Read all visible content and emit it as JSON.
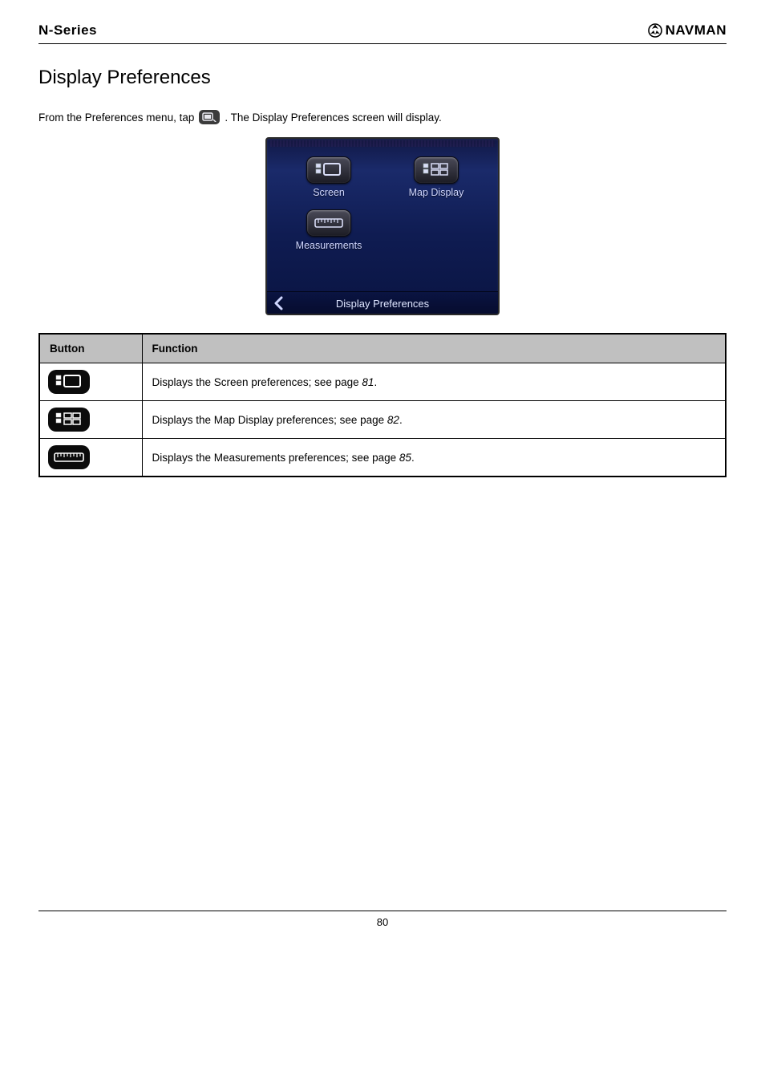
{
  "header": {
    "series": "N-Series",
    "brand": "NAVMAN"
  },
  "title": "Display Preferences",
  "intro": {
    "before_icon": "From the Preferences menu, tap",
    "after_icon": ". The Display Preferences screen will display."
  },
  "screenshot": {
    "items": [
      {
        "label": "Screen"
      },
      {
        "label": "Map Display"
      },
      {
        "label": "Measurements"
      }
    ],
    "footer_title": "Display Preferences"
  },
  "table": {
    "headers": [
      "Button",
      "Function"
    ],
    "rows": [
      {
        "function_prefix": "Displays the Screen preferences; see page ",
        "page_ref": "81",
        "function_suffix": "."
      },
      {
        "function_prefix": "Displays the Map Display preferences; see page ",
        "page_ref": "82",
        "function_suffix": "."
      },
      {
        "function_prefix": "Displays the Measurements preferences; see page ",
        "page_ref": "85",
        "function_suffix": "."
      }
    ]
  },
  "footer": {
    "page_number": "80"
  }
}
